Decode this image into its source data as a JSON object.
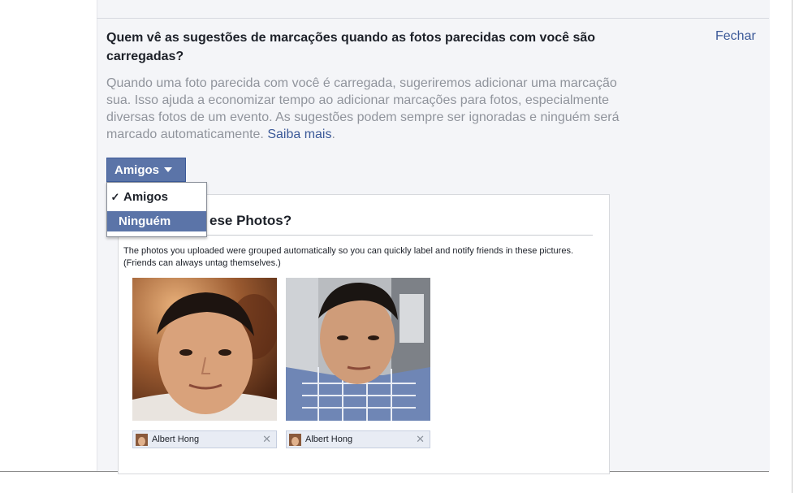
{
  "clipped_text": "",
  "setting": {
    "question": "Quem vê as sugestões de marcações quando as fotos parecidas com você são carregadas?",
    "close_label": "Fechar",
    "description": "Quando uma foto parecida com você é carregada, sugeriremos adicionar uma marcação sua. Isso ajuda a economizar tempo ao adicionar marcações para fotos, especialmente diversas fotos de um evento. As sugestões podem sempre ser ignoradas e ninguém será marcado automaticamente.",
    "learn_more": "Saiba mais",
    "period": "."
  },
  "dropdown": {
    "selected": "Amigos",
    "options": [
      {
        "label": "Amigos",
        "checked": true
      },
      {
        "label": "Ninguém",
        "highlighted": true
      }
    ]
  },
  "preview": {
    "title": "ese Photos?",
    "body": "The photos you uploaded were grouped automatically so you can quickly label and notify friends in these pictures. (Friends can always untag themselves.)",
    "photos": [
      {
        "tag_name": "Albert Hong"
      },
      {
        "tag_name": "Albert Hong"
      }
    ]
  },
  "icons": {
    "check": "check-icon",
    "caret": "caret-down-icon",
    "remove": "close-icon"
  },
  "colors": {
    "accent": "#5b74a8",
    "link": "#3b5998",
    "muted": "#90949c"
  }
}
